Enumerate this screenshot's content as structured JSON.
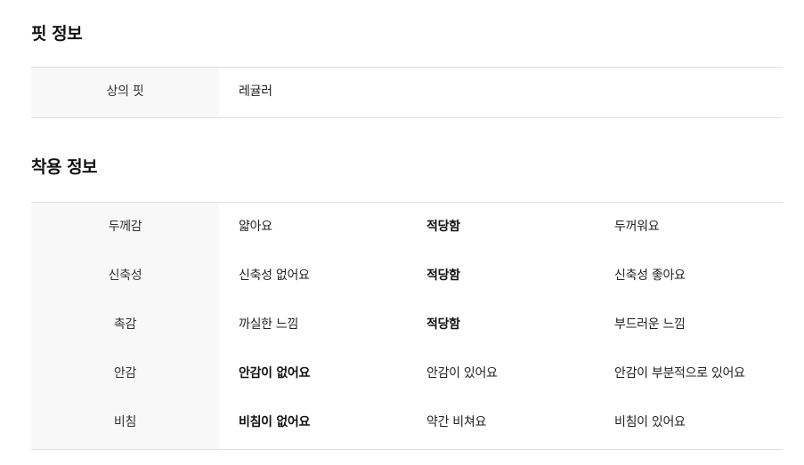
{
  "fit_section": {
    "title": "핏 정보",
    "rows": [
      {
        "label": "상의 핏",
        "value": "레귤러"
      }
    ]
  },
  "wear_section": {
    "title": "착용 정보",
    "rows": [
      {
        "label": "두께감",
        "options": [
          "얇아요",
          "적당함",
          "두꺼워요"
        ],
        "selected": 1
      },
      {
        "label": "신축성",
        "options": [
          "신축성 없어요",
          "적당함",
          "신축성 좋아요"
        ],
        "selected": 1
      },
      {
        "label": "촉감",
        "options": [
          "까실한 느낌",
          "적당함",
          "부드러운 느낌"
        ],
        "selected": 1
      },
      {
        "label": "안감",
        "options": [
          "안감이 없어요",
          "안감이 있어요",
          "안감이 부분적으로 있어요"
        ],
        "selected": 0
      },
      {
        "label": "비침",
        "options": [
          "비침이 없어요",
          "약간 비쳐요",
          "비침이 있어요"
        ],
        "selected": 0
      }
    ]
  }
}
